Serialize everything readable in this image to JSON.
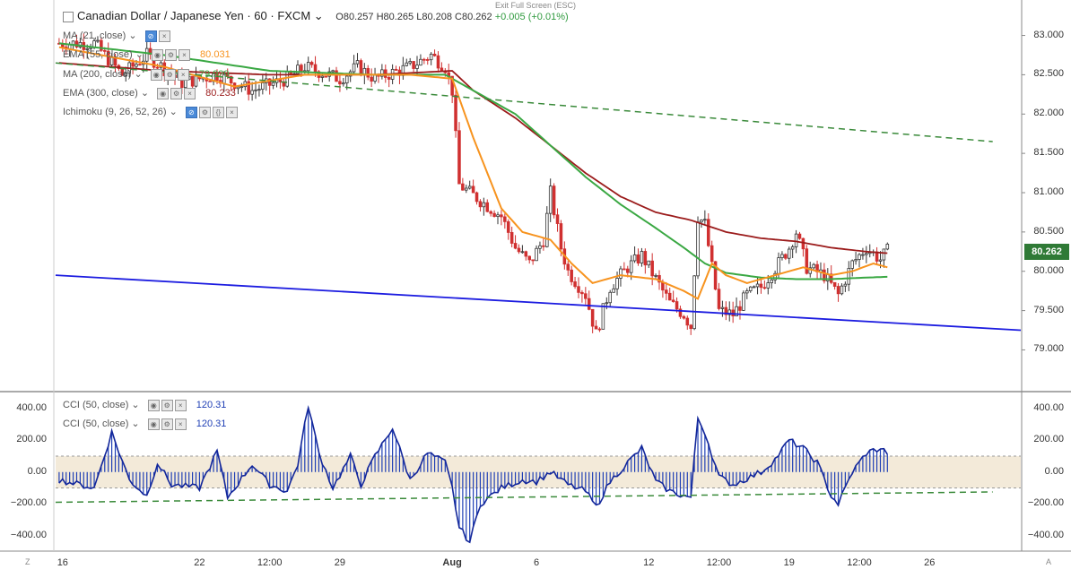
{
  "header": {
    "exit_label": "Exit Full Screen (ESC)",
    "symbol": "Canadian Dollar / Japanese Yen · 60 · FXCM",
    "open": "O80.257",
    "high": "H80.265",
    "low": "L80.208",
    "close": "C80.262",
    "change": "+0.005 (+0.01%)"
  },
  "indicators": [
    {
      "label": "MA (21, close)",
      "value": ""
    },
    {
      "label": "EMA (55, close)",
      "value": "80.031"
    },
    {
      "label": "MA (200, close)",
      "value": "79.929"
    },
    {
      "label": "EMA (300, close)",
      "value": "80.233"
    },
    {
      "label": "Ichimoku (9, 26, 52, 26)",
      "value": ""
    }
  ],
  "cci_legends": [
    {
      "label": "CCI (50, close)",
      "value": "120.31"
    },
    {
      "label": "CCI (50, close)",
      "value": "120.31"
    }
  ],
  "price_tag": "80.262",
  "corner_left": "Z",
  "corner_right": "A",
  "colors": {
    "ema55": "#f7931e",
    "ma200": "#3aa843",
    "ema300": "#9b1b1b",
    "cci": "#1f3fb5",
    "trend_blue": "#1c1ce0",
    "dash_green": "#3a8a3a",
    "band": "#efe3cc",
    "up": "#333333",
    "down": "#d03030"
  },
  "chart_data": {
    "type": "candlestick",
    "price_axis": {
      "ticks": [
        "83.000",
        "82.500",
        "82.000",
        "81.500",
        "81.000",
        "80.500",
        "80.000",
        "79.500",
        "79.000"
      ],
      "range": [
        78.8,
        83.2
      ]
    },
    "cci_axis": {
      "ticks": [
        "400.00",
        "200.00",
        "0.00",
        "−200.00",
        "−400.00"
      ],
      "range": [
        -480,
        500
      ],
      "band": [
        -100,
        100
      ]
    },
    "x_labels": [
      {
        "t": 1,
        "label": "16",
        "bold": false
      },
      {
        "t": 40,
        "label": "22",
        "bold": false
      },
      {
        "t": 60,
        "label": "12:00",
        "bold": false
      },
      {
        "t": 80,
        "label": "29",
        "bold": false
      },
      {
        "t": 112,
        "label": "Aug",
        "bold": true
      },
      {
        "t": 136,
        "label": "6",
        "bold": false
      },
      {
        "t": 168,
        "label": "12",
        "bold": false
      },
      {
        "t": 188,
        "label": "12:00",
        "bold": false
      },
      {
        "t": 208,
        "label": "19",
        "bold": false
      },
      {
        "t": 228,
        "label": "12:00",
        "bold": false
      },
      {
        "t": 248,
        "label": "26",
        "bold": false
      }
    ],
    "trendlines": [
      {
        "name": "descending-support",
        "from": [
          -1,
          79.95
        ],
        "to": [
          274,
          79.25
        ],
        "style": "solid"
      },
      {
        "name": "descending-resistance",
        "from": [
          -1,
          82.65
        ],
        "to": [
          266,
          81.65
        ],
        "style": "dashed"
      }
    ],
    "cci_trendline": {
      "from": [
        -1,
        -190
      ],
      "to": [
        266,
        -125
      ]
    },
    "anchors": {
      "close": [
        [
          0,
          82.9
        ],
        [
          10,
          82.9
        ],
        [
          18,
          82.5
        ],
        [
          25,
          82.75
        ],
        [
          35,
          82.4
        ],
        [
          45,
          82.5
        ],
        [
          55,
          82.3
        ],
        [
          65,
          82.45
        ],
        [
          70,
          82.6
        ],
        [
          80,
          82.45
        ],
        [
          85,
          82.6
        ],
        [
          90,
          82.45
        ],
        [
          100,
          82.6
        ],
        [
          106,
          82.75
        ],
        [
          110,
          82.6
        ],
        [
          112,
          82.3
        ],
        [
          113,
          81.7
        ],
        [
          114,
          81.1
        ],
        [
          120,
          80.9
        ],
        [
          126,
          80.7
        ],
        [
          130,
          80.3
        ],
        [
          134,
          80.1
        ],
        [
          138,
          80.4
        ],
        [
          140,
          81.0
        ],
        [
          143,
          80.3
        ],
        [
          145,
          80.0
        ],
        [
          150,
          79.7
        ],
        [
          153,
          79.2
        ],
        [
          157,
          79.8
        ],
        [
          162,
          80.05
        ],
        [
          166,
          80.2
        ],
        [
          170,
          79.9
        ],
        [
          174,
          79.6
        ],
        [
          178,
          79.45
        ],
        [
          180,
          79.3
        ],
        [
          182,
          80.7
        ],
        [
          184,
          80.6
        ],
        [
          188,
          79.5
        ],
        [
          192,
          79.45
        ],
        [
          196,
          79.7
        ],
        [
          200,
          79.8
        ],
        [
          205,
          80.1
        ],
        [
          208,
          80.3
        ],
        [
          210,
          80.5
        ],
        [
          213,
          80.05
        ],
        [
          218,
          79.95
        ],
        [
          222,
          79.7
        ],
        [
          226,
          80.1
        ],
        [
          230,
          80.3
        ],
        [
          234,
          80.15
        ],
        [
          236,
          80.26
        ]
      ],
      "ema55": [
        [
          0,
          82.85
        ],
        [
          30,
          82.6
        ],
        [
          50,
          82.35
        ],
        [
          70,
          82.5
        ],
        [
          100,
          82.5
        ],
        [
          112,
          82.45
        ],
        [
          118,
          81.7
        ],
        [
          126,
          80.8
        ],
        [
          132,
          80.5
        ],
        [
          140,
          80.4
        ],
        [
          146,
          80.1
        ],
        [
          152,
          79.85
        ],
        [
          160,
          79.95
        ],
        [
          170,
          79.9
        ],
        [
          178,
          79.75
        ],
        [
          182,
          79.65
        ],
        [
          186,
          80.1
        ],
        [
          190,
          79.95
        ],
        [
          196,
          79.85
        ],
        [
          204,
          79.95
        ],
        [
          212,
          80.05
        ],
        [
          220,
          79.95
        ],
        [
          226,
          80.0
        ],
        [
          232,
          80.1
        ],
        [
          236,
          80.05
        ]
      ],
      "ma200": [
        [
          0,
          82.9
        ],
        [
          30,
          82.75
        ],
        [
          60,
          82.55
        ],
        [
          90,
          82.5
        ],
        [
          110,
          82.5
        ],
        [
          118,
          82.3
        ],
        [
          130,
          82.0
        ],
        [
          140,
          81.6
        ],
        [
          150,
          81.2
        ],
        [
          160,
          80.85
        ],
        [
          170,
          80.55
        ],
        [
          178,
          80.3
        ],
        [
          184,
          80.1
        ],
        [
          190,
          79.98
        ],
        [
          200,
          79.92
        ],
        [
          210,
          79.9
        ],
        [
          220,
          79.9
        ],
        [
          230,
          79.92
        ],
        [
          236,
          79.93
        ]
      ],
      "ema300": [
        [
          0,
          82.65
        ],
        [
          30,
          82.55
        ],
        [
          60,
          82.5
        ],
        [
          90,
          82.5
        ],
        [
          112,
          82.55
        ],
        [
          118,
          82.3
        ],
        [
          130,
          81.95
        ],
        [
          140,
          81.6
        ],
        [
          150,
          81.25
        ],
        [
          160,
          80.95
        ],
        [
          170,
          80.75
        ],
        [
          180,
          80.65
        ],
        [
          190,
          80.5
        ],
        [
          200,
          80.42
        ],
        [
          210,
          80.38
        ],
        [
          220,
          80.3
        ],
        [
          230,
          80.25
        ],
        [
          236,
          80.23
        ]
      ],
      "cci": [
        [
          0,
          -50
        ],
        [
          10,
          -100
        ],
        [
          15,
          250
        ],
        [
          20,
          -50
        ],
        [
          25,
          -150
        ],
        [
          28,
          60
        ],
        [
          32,
          -80
        ],
        [
          40,
          -100
        ],
        [
          45,
          130
        ],
        [
          48,
          -160
        ],
        [
          55,
          50
        ],
        [
          60,
          -80
        ],
        [
          65,
          -120
        ],
        [
          68,
          50
        ],
        [
          71,
          420
        ],
        [
          74,
          120
        ],
        [
          78,
          -100
        ],
        [
          83,
          100
        ],
        [
          86,
          -80
        ],
        [
          90,
          100
        ],
        [
          95,
          280
        ],
        [
          100,
          -50
        ],
        [
          105,
          120
        ],
        [
          110,
          60
        ],
        [
          112,
          -100
        ],
        [
          114,
          -350
        ],
        [
          117,
          -440
        ],
        [
          120,
          -200
        ],
        [
          126,
          -100
        ],
        [
          132,
          -50
        ],
        [
          136,
          -60
        ],
        [
          140,
          0
        ],
        [
          145,
          -80
        ],
        [
          150,
          -120
        ],
        [
          153,
          -220
        ],
        [
          157,
          -60
        ],
        [
          162,
          60
        ],
        [
          166,
          150
        ],
        [
          170,
          -60
        ],
        [
          174,
          -120
        ],
        [
          178,
          -150
        ],
        [
          180,
          -160
        ],
        [
          182,
          340
        ],
        [
          184,
          250
        ],
        [
          188,
          -30
        ],
        [
          192,
          -80
        ],
        [
          196,
          -40
        ],
        [
          200,
          0
        ],
        [
          204,
          80
        ],
        [
          208,
          200
        ],
        [
          212,
          150
        ],
        [
          216,
          60
        ],
        [
          220,
          -150
        ],
        [
          222,
          -200
        ],
        [
          226,
          0
        ],
        [
          230,
          120
        ],
        [
          234,
          150
        ],
        [
          236,
          120
        ]
      ]
    }
  }
}
